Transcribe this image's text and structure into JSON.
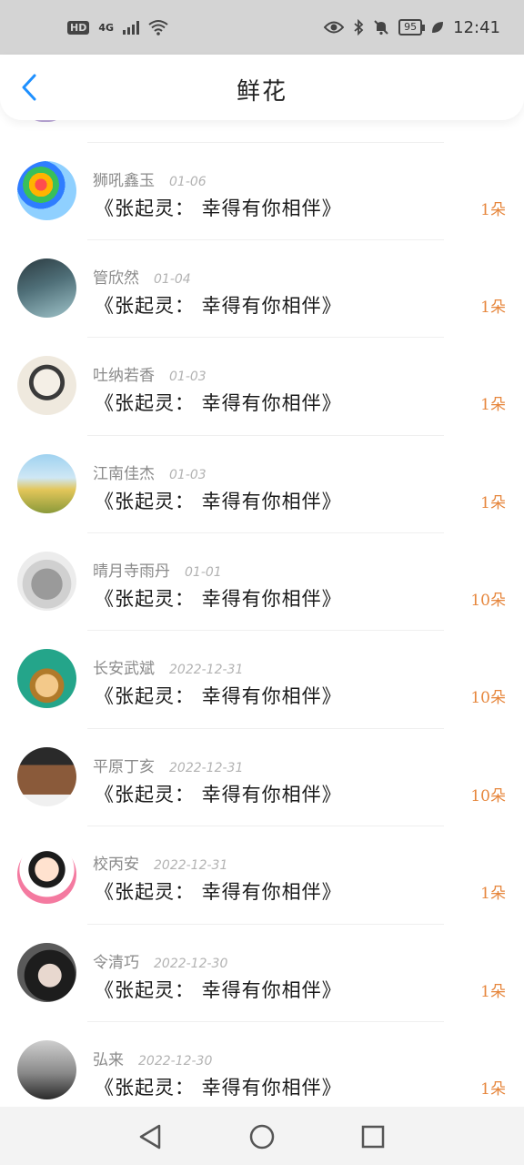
{
  "status_bar": {
    "hd": "HD",
    "network": "4G",
    "battery": "95",
    "time": "12:41"
  },
  "header": {
    "title": "鲜花"
  },
  "colors": {
    "accent": "#e6863c",
    "back_arrow": "#1e90ff"
  },
  "items": [
    {
      "name": "狮吼鑫玉",
      "date": "01-06",
      "gift": "《张起灵： 幸得有你相伴》",
      "amount": "1朵"
    },
    {
      "name": "管欣然",
      "date": "01-04",
      "gift": "《张起灵： 幸得有你相伴》",
      "amount": "1朵"
    },
    {
      "name": "吐纳若香",
      "date": "01-03",
      "gift": "《张起灵： 幸得有你相伴》",
      "amount": "1朵"
    },
    {
      "name": "江南佳杰",
      "date": "01-03",
      "gift": "《张起灵： 幸得有你相伴》",
      "amount": "1朵"
    },
    {
      "name": "晴月寺雨丹",
      "date": "01-01",
      "gift": "《张起灵： 幸得有你相伴》",
      "amount": "10朵"
    },
    {
      "name": "长安武斌",
      "date": "2022-12-31",
      "gift": "《张起灵： 幸得有你相伴》",
      "amount": "10朵"
    },
    {
      "name": "平原丁亥",
      "date": "2022-12-31",
      "gift": "《张起灵： 幸得有你相伴》",
      "amount": "10朵"
    },
    {
      "name": "校丙安",
      "date": "2022-12-31",
      "gift": "《张起灵： 幸得有你相伴》",
      "amount": "1朵"
    },
    {
      "name": "令清巧",
      "date": "2022-12-30",
      "gift": "《张起灵： 幸得有你相伴》",
      "amount": "1朵"
    },
    {
      "name": "弘来",
      "date": "2022-12-30",
      "gift": "《张起灵： 幸得有你相伴》",
      "amount": "1朵"
    }
  ]
}
